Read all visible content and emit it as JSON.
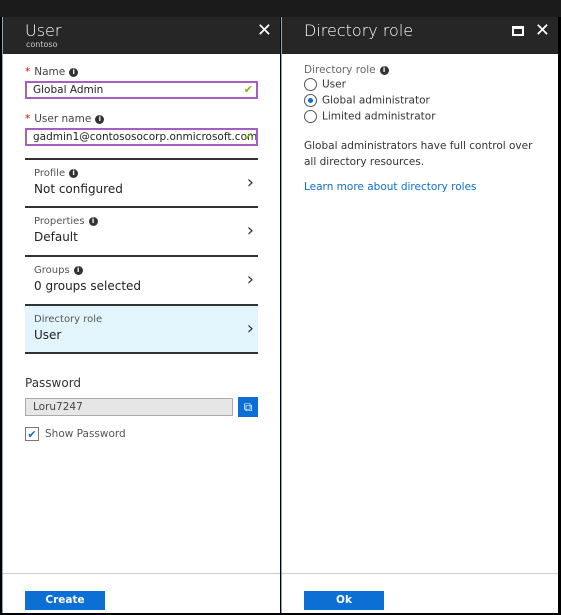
{
  "user_blade": {
    "title": "User",
    "subtitle": "contoso",
    "close_icon": "close-icon",
    "name": {
      "label": "Name",
      "value": "Global Admin"
    },
    "username": {
      "label": "User name",
      "value": "gadmin1@contososocorp.onmicrosoft.com"
    },
    "rows": [
      {
        "label": "Profile",
        "value": "Not configured"
      },
      {
        "label": "Properties",
        "value": "Default"
      },
      {
        "label": "Groups",
        "value": "0 groups selected"
      },
      {
        "label": "Directory role",
        "value": "User"
      }
    ],
    "password": {
      "label": "Password",
      "value": "Loru7247",
      "show_label": "Show Password",
      "show_checked": true
    },
    "create_label": "Create"
  },
  "role_blade": {
    "title": "Directory role",
    "field_label": "Directory role",
    "options": [
      {
        "label": "User",
        "selected": false
      },
      {
        "label": "Global administrator",
        "selected": true
      },
      {
        "label": "Limited administrator",
        "selected": false
      }
    ],
    "description": "Global administrators have full control over all directory resources.",
    "link": "Learn more about directory roles",
    "ok_label": "Ok"
  },
  "colors": {
    "accent": "#0b6fd4",
    "header": "#262626",
    "selected_row": "#e3f5fc",
    "valid_border": "#a55fbf"
  }
}
